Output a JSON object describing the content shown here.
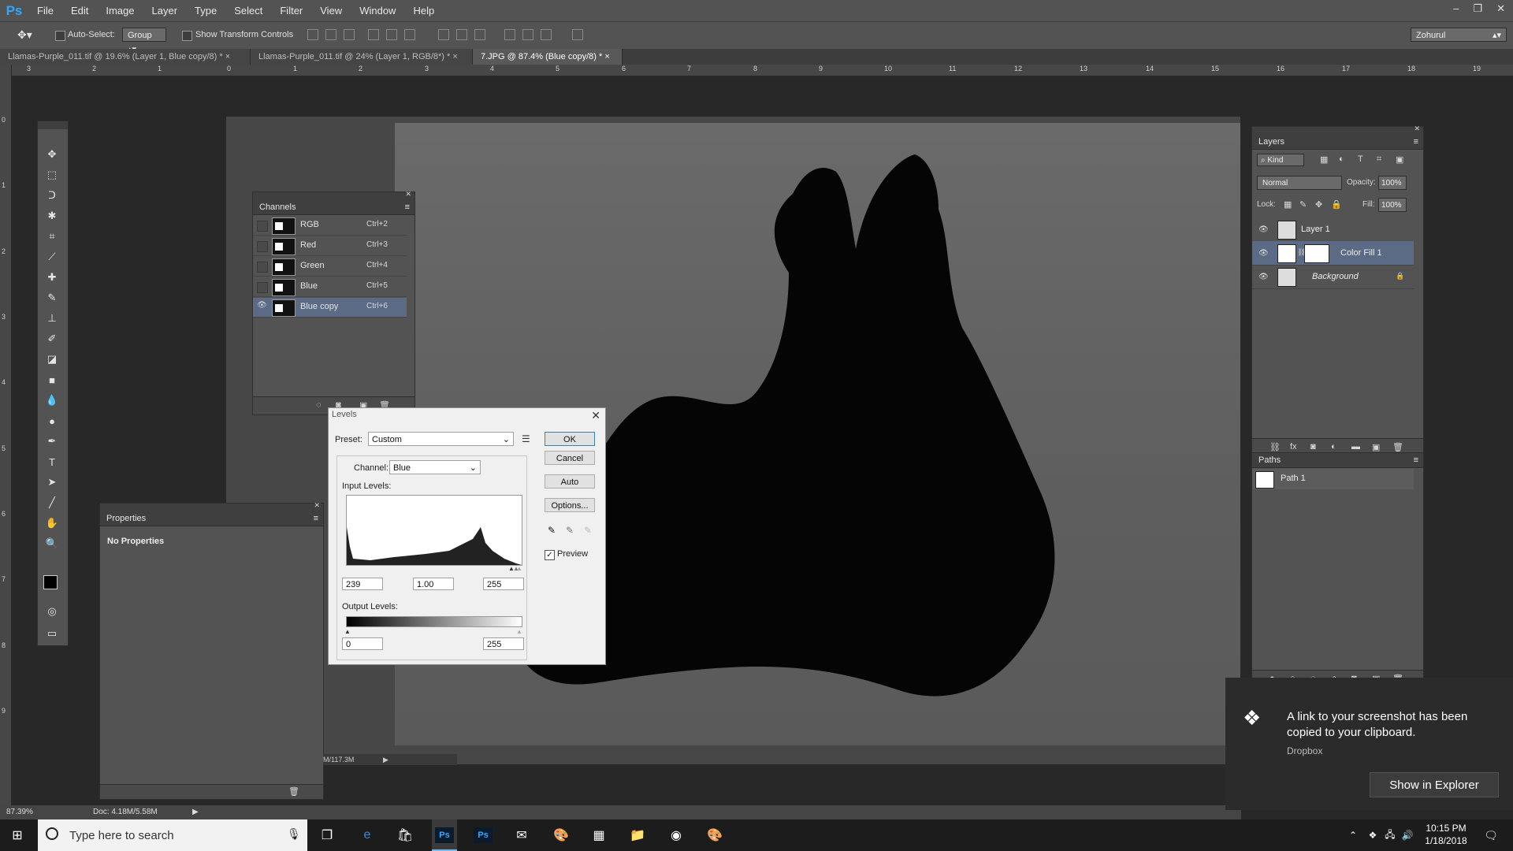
{
  "app": {
    "logo": "Ps",
    "menu": [
      "File",
      "Edit",
      "Image",
      "Layer",
      "Type",
      "Select",
      "Filter",
      "View",
      "Window",
      "Help"
    ],
    "window_controls": [
      "–",
      "❐",
      "✕"
    ]
  },
  "options_bar": {
    "auto_select_label": "Auto-Select:",
    "auto_select_value": "Group",
    "show_transform_label": "Show Transform Controls",
    "workspace": "Zohurul"
  },
  "tabs": [
    {
      "label": "Llamas-Purple_011.tif @ 19.6% (Layer 1, Blue copy/8) *",
      "close": "×"
    },
    {
      "label": "Llamas-Purple_011.tif @ 24% (Layer 1, RGB/8*) *",
      "close": "×"
    },
    {
      "label": "7.JPG @ 87.4% (Blue copy/8) *",
      "close": "×"
    }
  ],
  "ruler": {
    "h_labels": [
      "3",
      "2",
      "1",
      "0",
      "1",
      "2",
      "3",
      "4",
      "5",
      "6",
      "7",
      "8",
      "9",
      "10",
      "11",
      "12",
      "13",
      "14",
      "15",
      "16",
      "17",
      "18",
      "19"
    ],
    "v_labels": [
      "0",
      "1",
      "2",
      "3",
      "4",
      "5",
      "6",
      "7",
      "8",
      "9"
    ]
  },
  "channels": {
    "title": "Channels",
    "rows": [
      {
        "name": "RGB",
        "key": "Ctrl+2",
        "selected": false
      },
      {
        "name": "Red",
        "key": "Ctrl+3",
        "selected": false
      },
      {
        "name": "Green",
        "key": "Ctrl+4",
        "selected": false
      },
      {
        "name": "Blue",
        "key": "Ctrl+5",
        "selected": false
      },
      {
        "name": "Blue copy",
        "key": "Ctrl+6",
        "selected": true
      }
    ]
  },
  "properties": {
    "title": "Properties",
    "body": "No Properties"
  },
  "levels": {
    "title": "Levels",
    "preset_label": "Preset:",
    "preset_value": "Custom",
    "channel_label": "Channel:",
    "channel_value": "Blue",
    "input_label": "Input Levels:",
    "input_black": "239",
    "input_gamma": "1.00",
    "input_white": "255",
    "output_label": "Output Levels:",
    "output_black": "0",
    "output_white": "255",
    "ok": "OK",
    "cancel": "Cancel",
    "auto": "Auto",
    "options": "Options...",
    "preview_label": "Preview"
  },
  "layers": {
    "title": "Layers",
    "kind": "Kind",
    "blend": "Normal",
    "opacity_label": "Opacity:",
    "opacity": "100%",
    "lock_label": "Lock:",
    "fill_label": "Fill:",
    "fill": "100%",
    "rows": [
      {
        "name": "Layer 1",
        "selected": false
      },
      {
        "name": "Color Fill 1",
        "selected": true
      },
      {
        "name": "Background",
        "selected": false
      }
    ]
  },
  "paths": {
    "title": "Paths",
    "rows": [
      {
        "name": "Path 1"
      }
    ]
  },
  "status": {
    "zoom": "87.39%",
    "doc": "Doc: 4.18M/5.58M",
    "inner_doc": "M/117.3M"
  },
  "toast": {
    "message": "A link to your screenshot has been copied to your clipboard.",
    "source": "Dropbox",
    "button": "Show in Explorer"
  },
  "taskbar": {
    "search_placeholder": "Type here to search",
    "time": "10:15 PM",
    "date": "1/18/2018"
  },
  "colors": {
    "accent_blue": "#31a8ff",
    "selection": "#5b6a85"
  }
}
